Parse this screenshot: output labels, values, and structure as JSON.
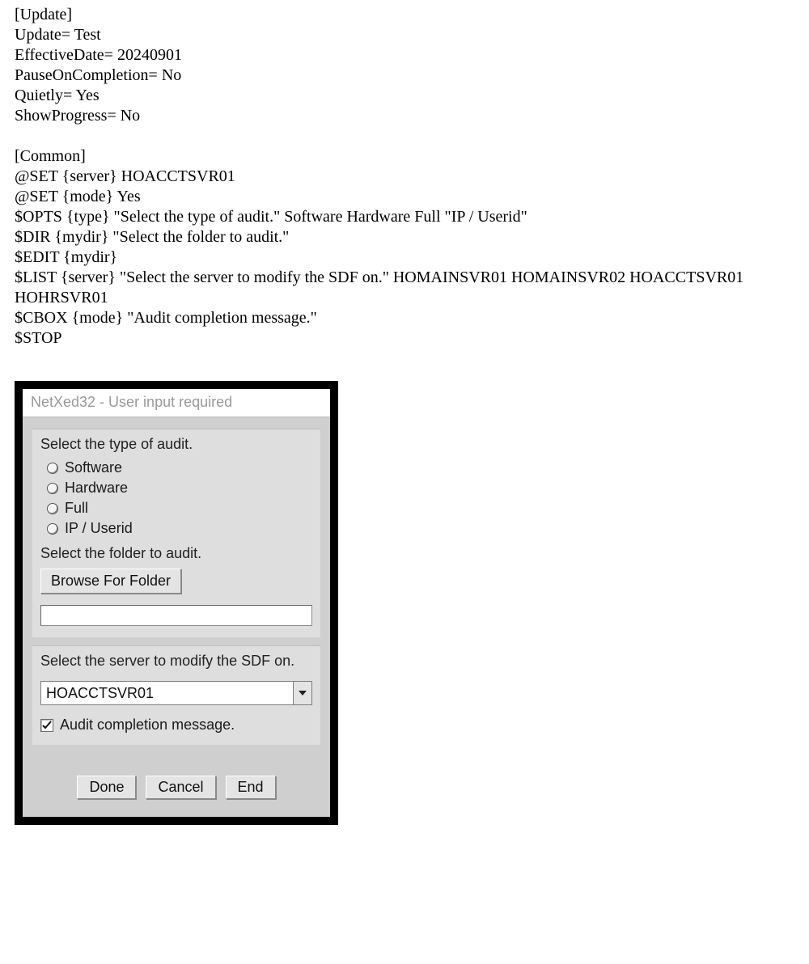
{
  "script": {
    "lines": [
      "[Update]",
      "Update= Test",
      "EffectiveDate= 20240901",
      "PauseOnCompletion= No",
      "Quietly= Yes",
      "ShowProgress= No",
      "",
      "[Common]",
      "@SET {server} HOACCTSVR01",
      "@SET {mode} Yes",
      "$OPTS {type} \"Select the type of audit.\" Software Hardware Full \"IP / Userid\"",
      "$DIR {mydir} \"Select the folder to audit.\"",
      "$EDIT {mydir}",
      "$LIST {server} \"Select the server to modify the SDF on.\" HOMAINSVR01 HOMAINSVR02 HOACCTSVR01 HOHRSVR01",
      "$CBOX {mode} \"Audit completion message.\"",
      "$STOP"
    ]
  },
  "dialog": {
    "title": "NetXed32 - User input required",
    "audit_type": {
      "label": "Select the type of audit.",
      "options": [
        "Software",
        "Hardware",
        "Full",
        "IP / Userid"
      ]
    },
    "folder": {
      "label": "Select the folder to audit.",
      "browse_label": "Browse For Folder",
      "value": ""
    },
    "server": {
      "label": "Select the server to modify the SDF on.",
      "selected": "HOACCTSVR01"
    },
    "checkbox": {
      "label": "Audit completion message.",
      "checked": true
    },
    "buttons": {
      "done": "Done",
      "cancel": "Cancel",
      "end": "End"
    }
  }
}
